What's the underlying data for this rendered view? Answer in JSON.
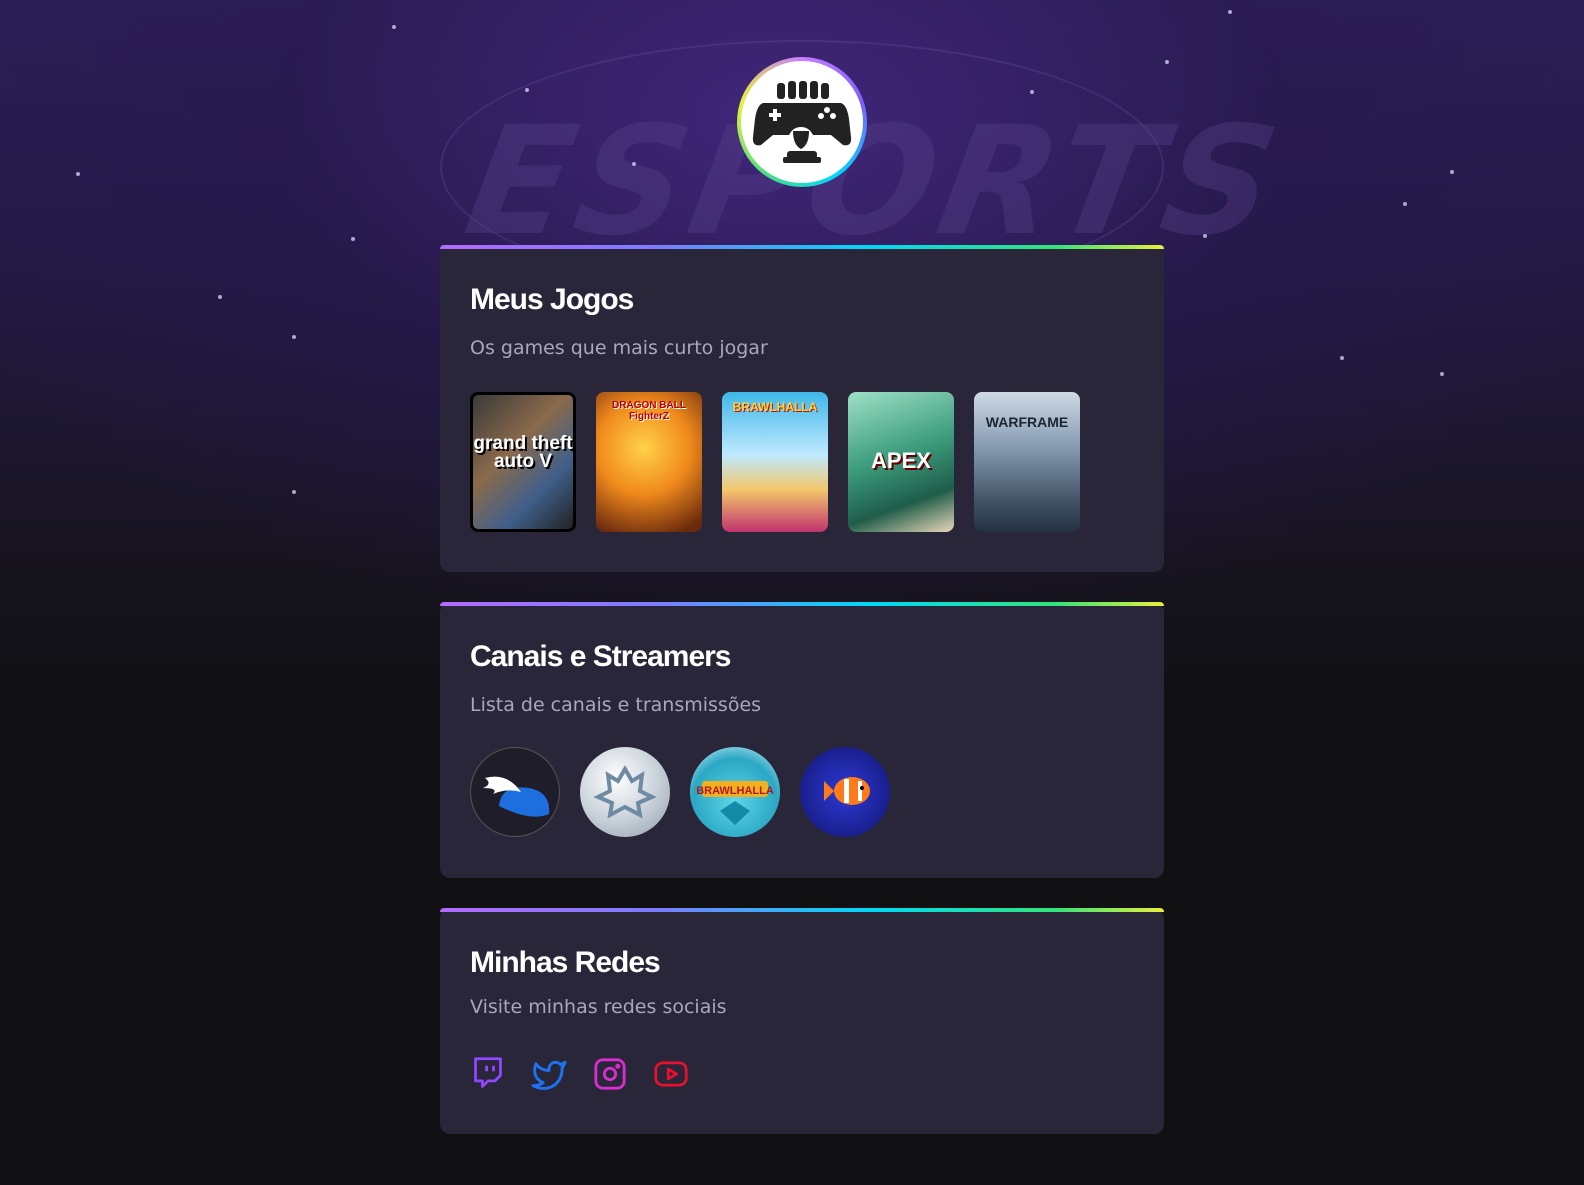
{
  "background": {
    "wordmark": "ESPORTS"
  },
  "profile": {
    "avatar_icon": "gamepad-trophy-icon"
  },
  "sections": {
    "games": {
      "title": "Meus Jogos",
      "subtitle": "Os games que mais curto jogar",
      "items": [
        {
          "name": "gta-v",
          "cover_text": "grand theft auto V"
        },
        {
          "name": "dragon-ball-fighterz",
          "cover_text": "DRAGON BALL FighterZ"
        },
        {
          "name": "brawlhalla",
          "cover_text": "BRAWLHALLA"
        },
        {
          "name": "apex-legends",
          "cover_text": "APEX"
        },
        {
          "name": "warframe",
          "cover_text": "WARFRAME"
        }
      ]
    },
    "channels": {
      "title": "Canais e Streamers",
      "subtitle": "Lista de canais e transmissões",
      "items": [
        {
          "name": "winged-helmet-channel"
        },
        {
          "name": "warframe-channel"
        },
        {
          "name": "brawlhalla-channel"
        },
        {
          "name": "clownfish-channel"
        }
      ]
    },
    "socials": {
      "title": "Minhas Redes",
      "subtitle": "Visite minhas redes sociais",
      "items": [
        {
          "name": "twitch",
          "icon": "twitch-icon",
          "color": "#9146ff"
        },
        {
          "name": "twitter",
          "icon": "twitter-icon",
          "color": "#1d72f2"
        },
        {
          "name": "instagram",
          "icon": "instagram-icon",
          "color": "#d62ecf"
        },
        {
          "name": "youtube",
          "icon": "youtube-icon",
          "color": "#e8112d"
        }
      ]
    }
  }
}
